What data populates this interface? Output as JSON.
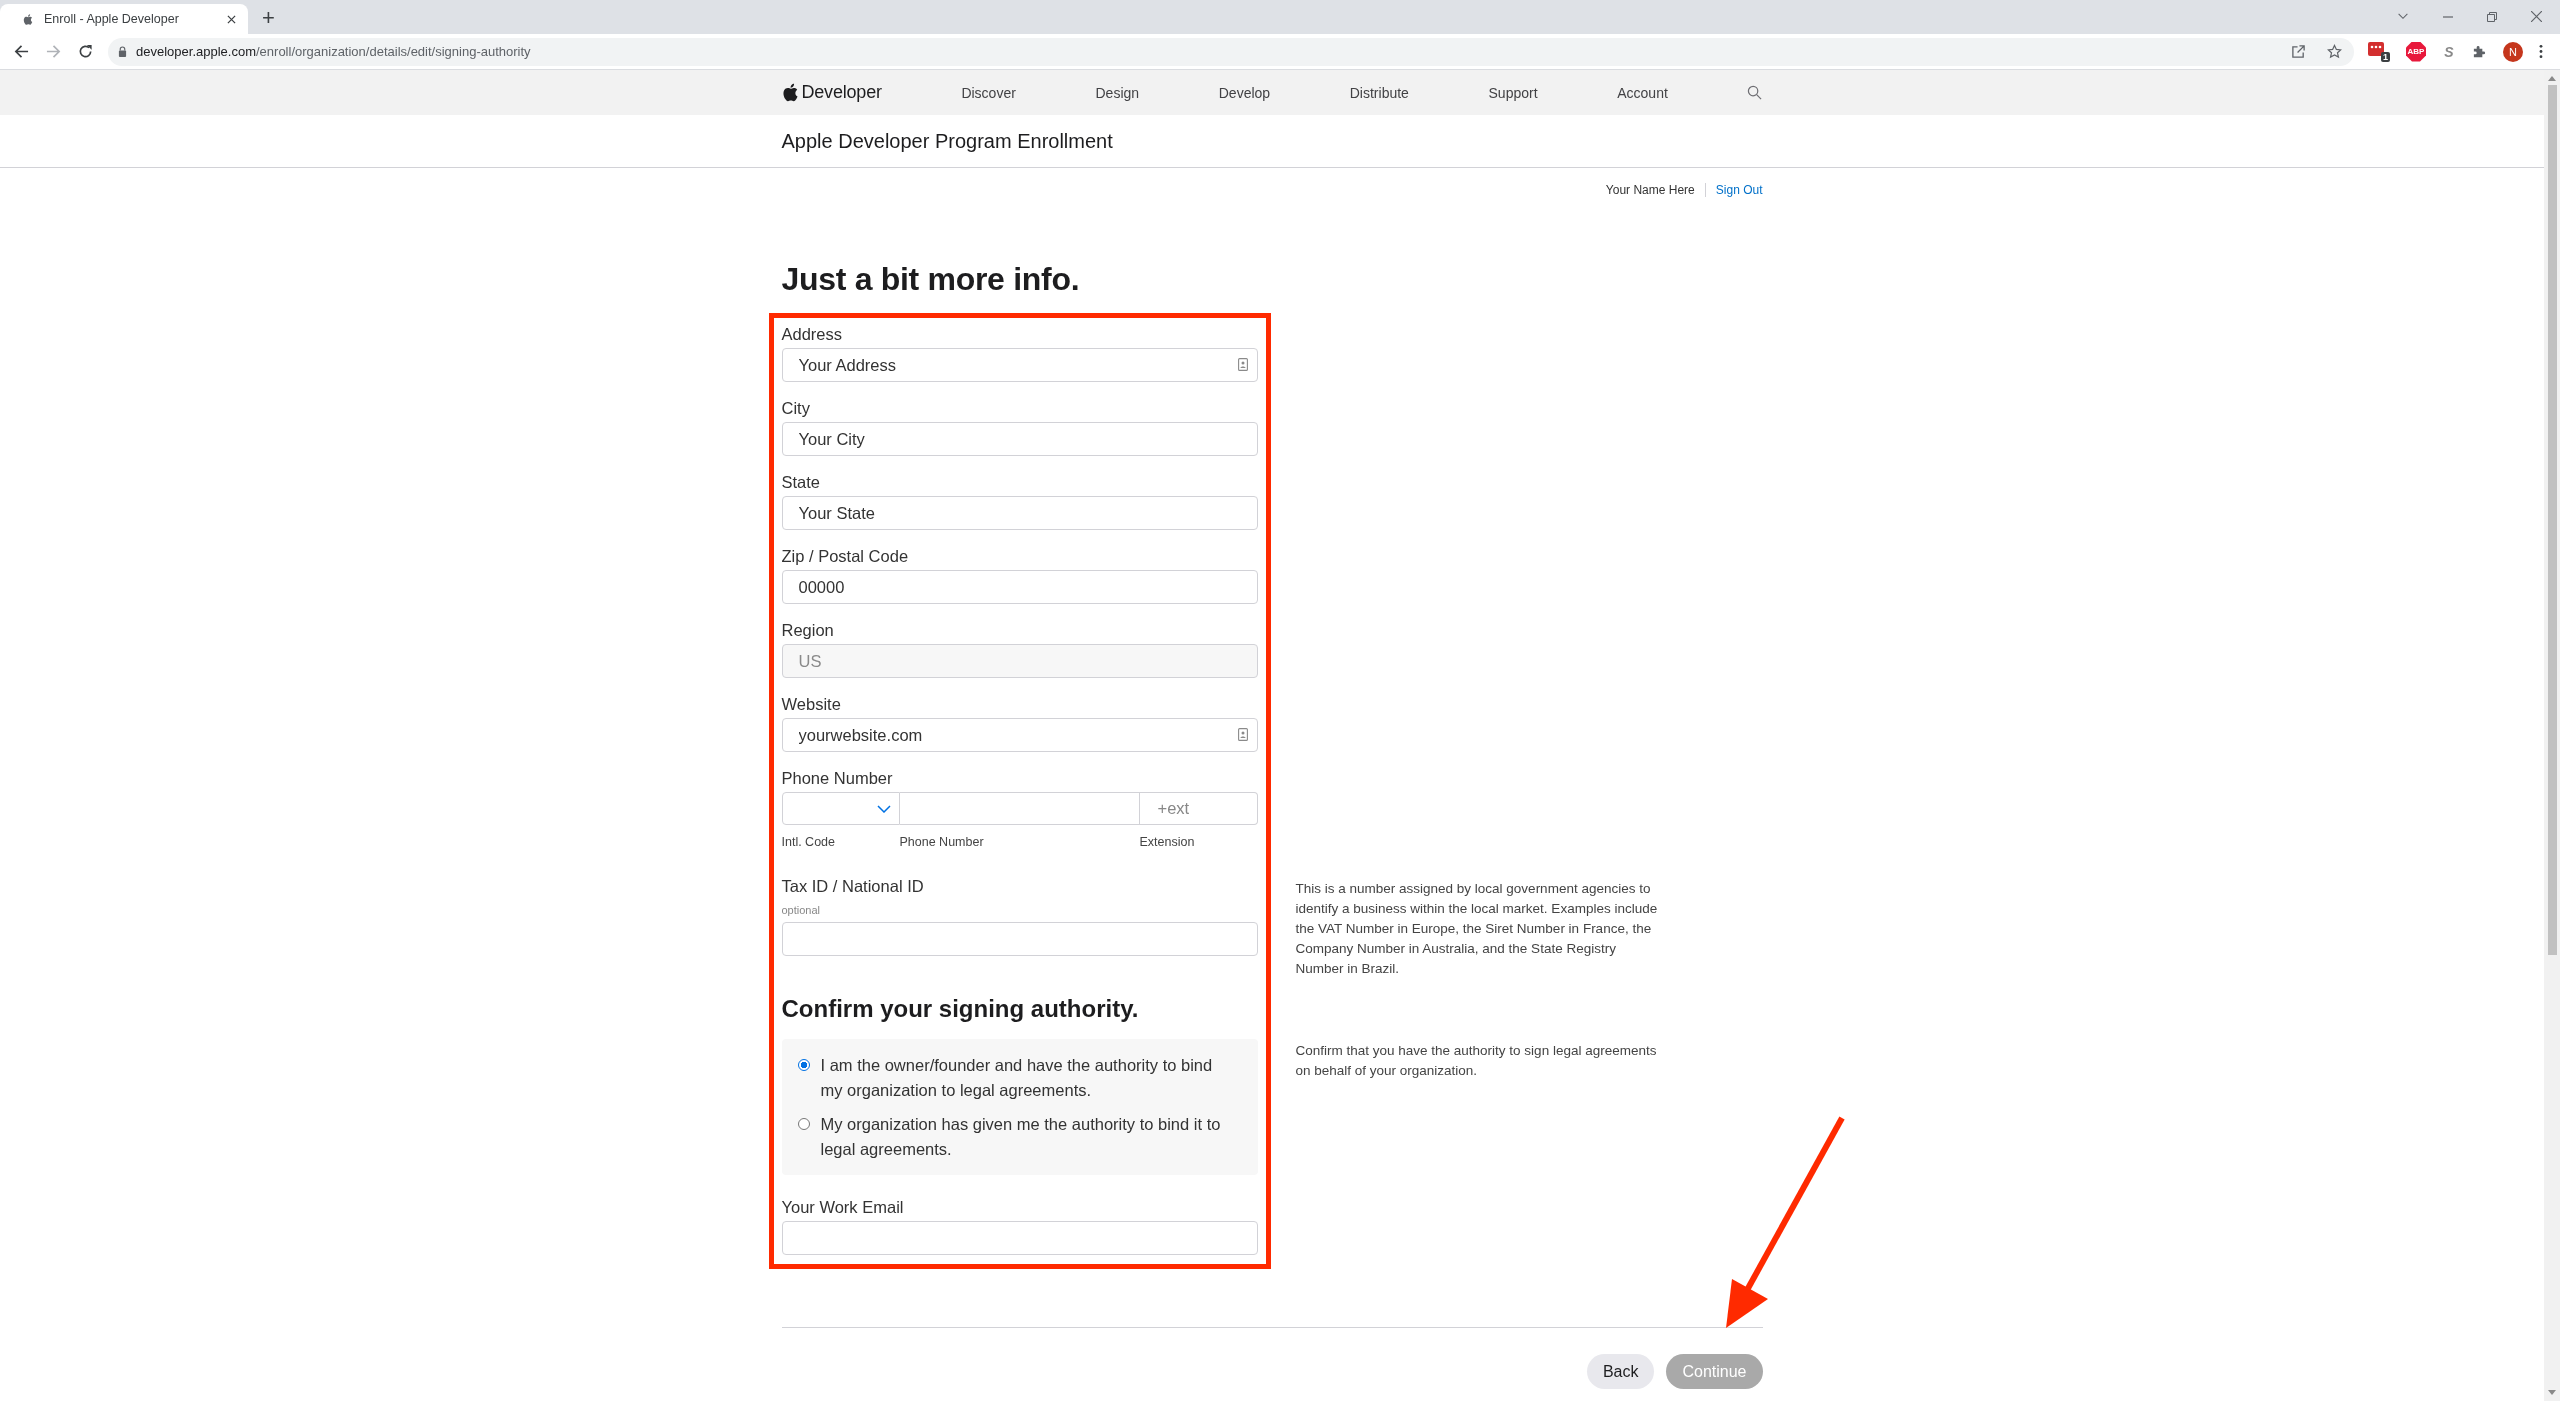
{
  "browser": {
    "tab": {
      "title": "Enroll - Apple Developer",
      "selected": true
    },
    "new_tab": "+",
    "url_host": "developer.apple.com",
    "url_path": "/enroll/organization/details/edit/signing-authority",
    "extensions": [
      {
        "kind": "dots",
        "label": "1"
      },
      {
        "kind": "octagon",
        "label": "ABP"
      },
      {
        "kind": "letter",
        "label": "S"
      },
      {
        "kind": "puzzle"
      }
    ],
    "profile": "N"
  },
  "nav": {
    "brand": "Developer",
    "items": [
      "Discover",
      "Design",
      "Develop",
      "Distribute",
      "Support",
      "Account"
    ]
  },
  "page_title": "Apple Developer Program Enrollment",
  "user": {
    "name": "Your Name Here",
    "sign_out": "Sign Out"
  },
  "heading": "Just a bit more info.",
  "fields": [
    {
      "label": "Address",
      "value": "Your Address",
      "autofill": true,
      "disabled": false
    },
    {
      "label": "City",
      "value": "Your City",
      "autofill": false,
      "disabled": false
    },
    {
      "label": "State",
      "value": "Your State",
      "autofill": false,
      "disabled": false
    },
    {
      "label": "Zip / Postal Code",
      "value": "00000",
      "autofill": false,
      "disabled": false
    },
    {
      "label": "Region",
      "value": "US",
      "autofill": false,
      "disabled": true
    },
    {
      "label": "Website",
      "value": "yourwebsite.com",
      "autofill": true,
      "disabled": false
    }
  ],
  "phone": {
    "label": "Phone Number",
    "ext_placeholder": "+ext",
    "sublabels": [
      "Intl. Code",
      "Phone Number",
      "Extension"
    ]
  },
  "tax": {
    "label": "Tax ID / National ID",
    "hint": "optional",
    "help": "This is a number assigned by local government agencies to identify a business within the local market. Examples include the VAT Number in Europe, the Siret Number in France, the Company Number in Australia, and the State Registry Number in Brazil."
  },
  "signing": {
    "heading": "Confirm your signing authority.",
    "options": [
      {
        "label": "I am the owner/founder and have the authority to bind my organization to legal agreements.",
        "selected": true
      },
      {
        "label": "My organization has given me the authority to bind it to legal agreements.",
        "selected": false
      }
    ],
    "help": "Confirm that you have the authority to sign legal agreements on behalf of your organization."
  },
  "email": {
    "label": "Your Work Email"
  },
  "buttons": [
    {
      "label": "Back",
      "disabled": false
    },
    {
      "label": "Continue",
      "disabled": true
    }
  ]
}
